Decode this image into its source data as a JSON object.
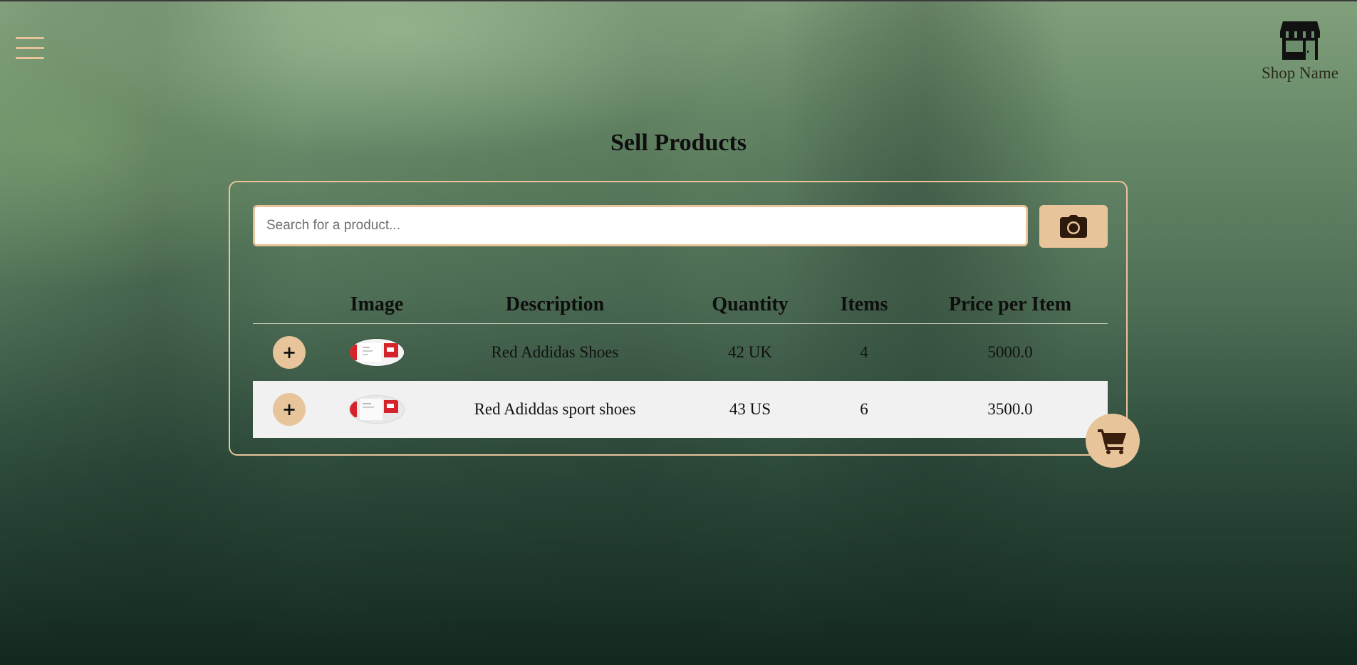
{
  "header": {
    "menu_icon": "hamburger-menu-icon",
    "shop_icon": "storefront-icon",
    "shop_name": "Shop Name"
  },
  "page": {
    "title": "Sell Products"
  },
  "search": {
    "placeholder": "Search for a product...",
    "value": "",
    "camera_icon": "camera-icon"
  },
  "table": {
    "columns": [
      "Image",
      "Description",
      "Quantity",
      "Items",
      "Price per Item"
    ],
    "rows": [
      {
        "add_label": "+",
        "image_alt": "red shoe",
        "description": "Red Addidas Shoes",
        "quantity": "42 UK",
        "items": "4",
        "price": "5000.0"
      },
      {
        "add_label": "+",
        "image_alt": "red shoe",
        "description": "Red Adiddas sport shoes",
        "quantity": "43 US",
        "items": "6",
        "price": "3500.0"
      }
    ]
  },
  "cart": {
    "icon": "shopping-cart-icon"
  },
  "colors": {
    "accent": "#e8c49b",
    "text_dark": "#0e0e0e",
    "row_alt_bg": "#f1f1f1",
    "icon_dark": "#3b1f0e"
  }
}
